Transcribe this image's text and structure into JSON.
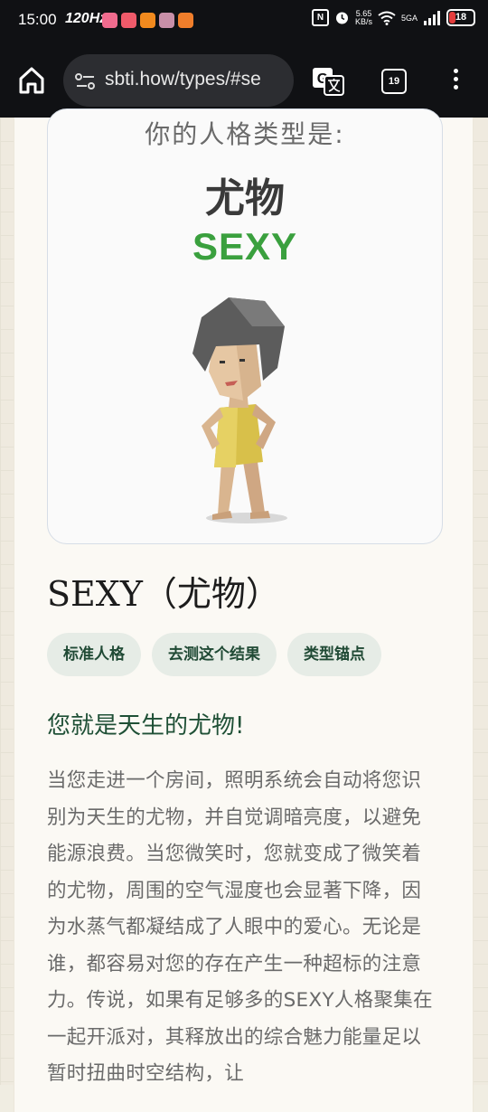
{
  "status_bar": {
    "time": "15:00",
    "refresh_rate": "120Hz",
    "nfc": "N",
    "net_speed_value": "5.65",
    "net_speed_unit": "KB/s",
    "network_type": "5GA",
    "battery": "18",
    "battery_color": "#e43c3c"
  },
  "browser": {
    "url": "sbti.how/types/#se",
    "tab_count": "19"
  },
  "poster": {
    "heading": "你的人格类型是:",
    "type_cn": "尤物",
    "type_en": "SEXY",
    "accent_color": "#3aa03e"
  },
  "result": {
    "title": "SEXY（尤物）",
    "chips": [
      "标准人格",
      "去测这个结果",
      "类型锚点"
    ],
    "subheading": "您就是天生的尤物!",
    "body": "当您走进一个房间，照明系统会自动将您识别为天生的尤物，并自觉调暗亮度，以避免能源浪费。当您微笑时，您就变成了微笑着的尤物，周围的空气湿度也会显著下降，因为水蒸气都凝结成了人眼中的爱心。无论是谁，都容易对您的存在产生一种超标的注意力。传说，如果有足够多的SEXY人格聚集在一起开派对，其释放出的综合魅力能量足以暂时扭曲时空结构，让"
  }
}
